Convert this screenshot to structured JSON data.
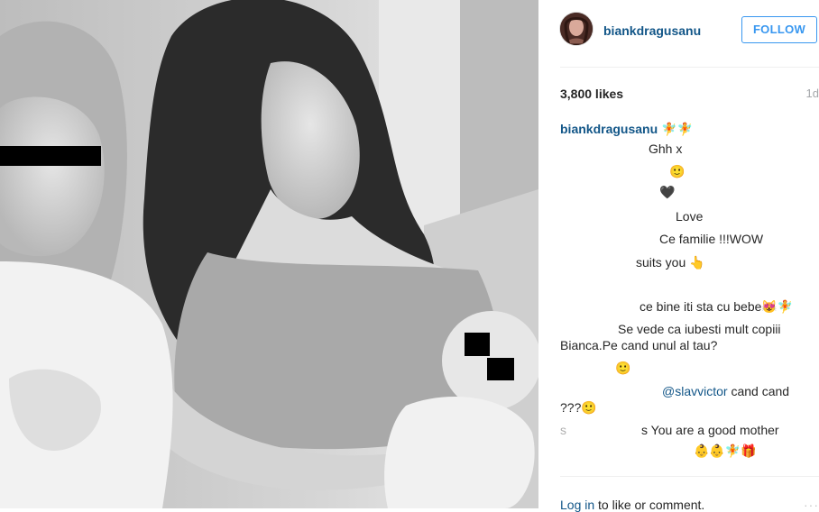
{
  "post": {
    "photo_alt": "",
    "author": {
      "username": "biankdragusanu",
      "avatar_color": "#4a2b25"
    },
    "follow_label": "FOLLOW",
    "likes": "3,800 likes",
    "age": "1d",
    "caption": {
      "username": "biankdragusanu",
      "emoji": "🧚🧚"
    },
    "comments": [
      "Ghh x",
      "🙂",
      "🖤",
      "Love",
      "Ce familie !!!WOW",
      "suits you 👆",
      "ce bine iti sta cu bebe😻🧚",
      "Se vede ca iubesti mult copiii",
      "Bianca.Pe cand unul al tau?",
      "🙂",
      "@slavvictor",
      "cand cand",
      "???🙂",
      "s",
      "s You are a good mother",
      "👶👶🧚🎁"
    ],
    "footer": {
      "login_link": "Log in",
      "login_text": " to like or comment.",
      "more_label": "···"
    },
    "colors": {
      "link": "#125688",
      "follow": "#3897f0",
      "muted": "#a5a7aa",
      "divider": "#efefef"
    }
  }
}
